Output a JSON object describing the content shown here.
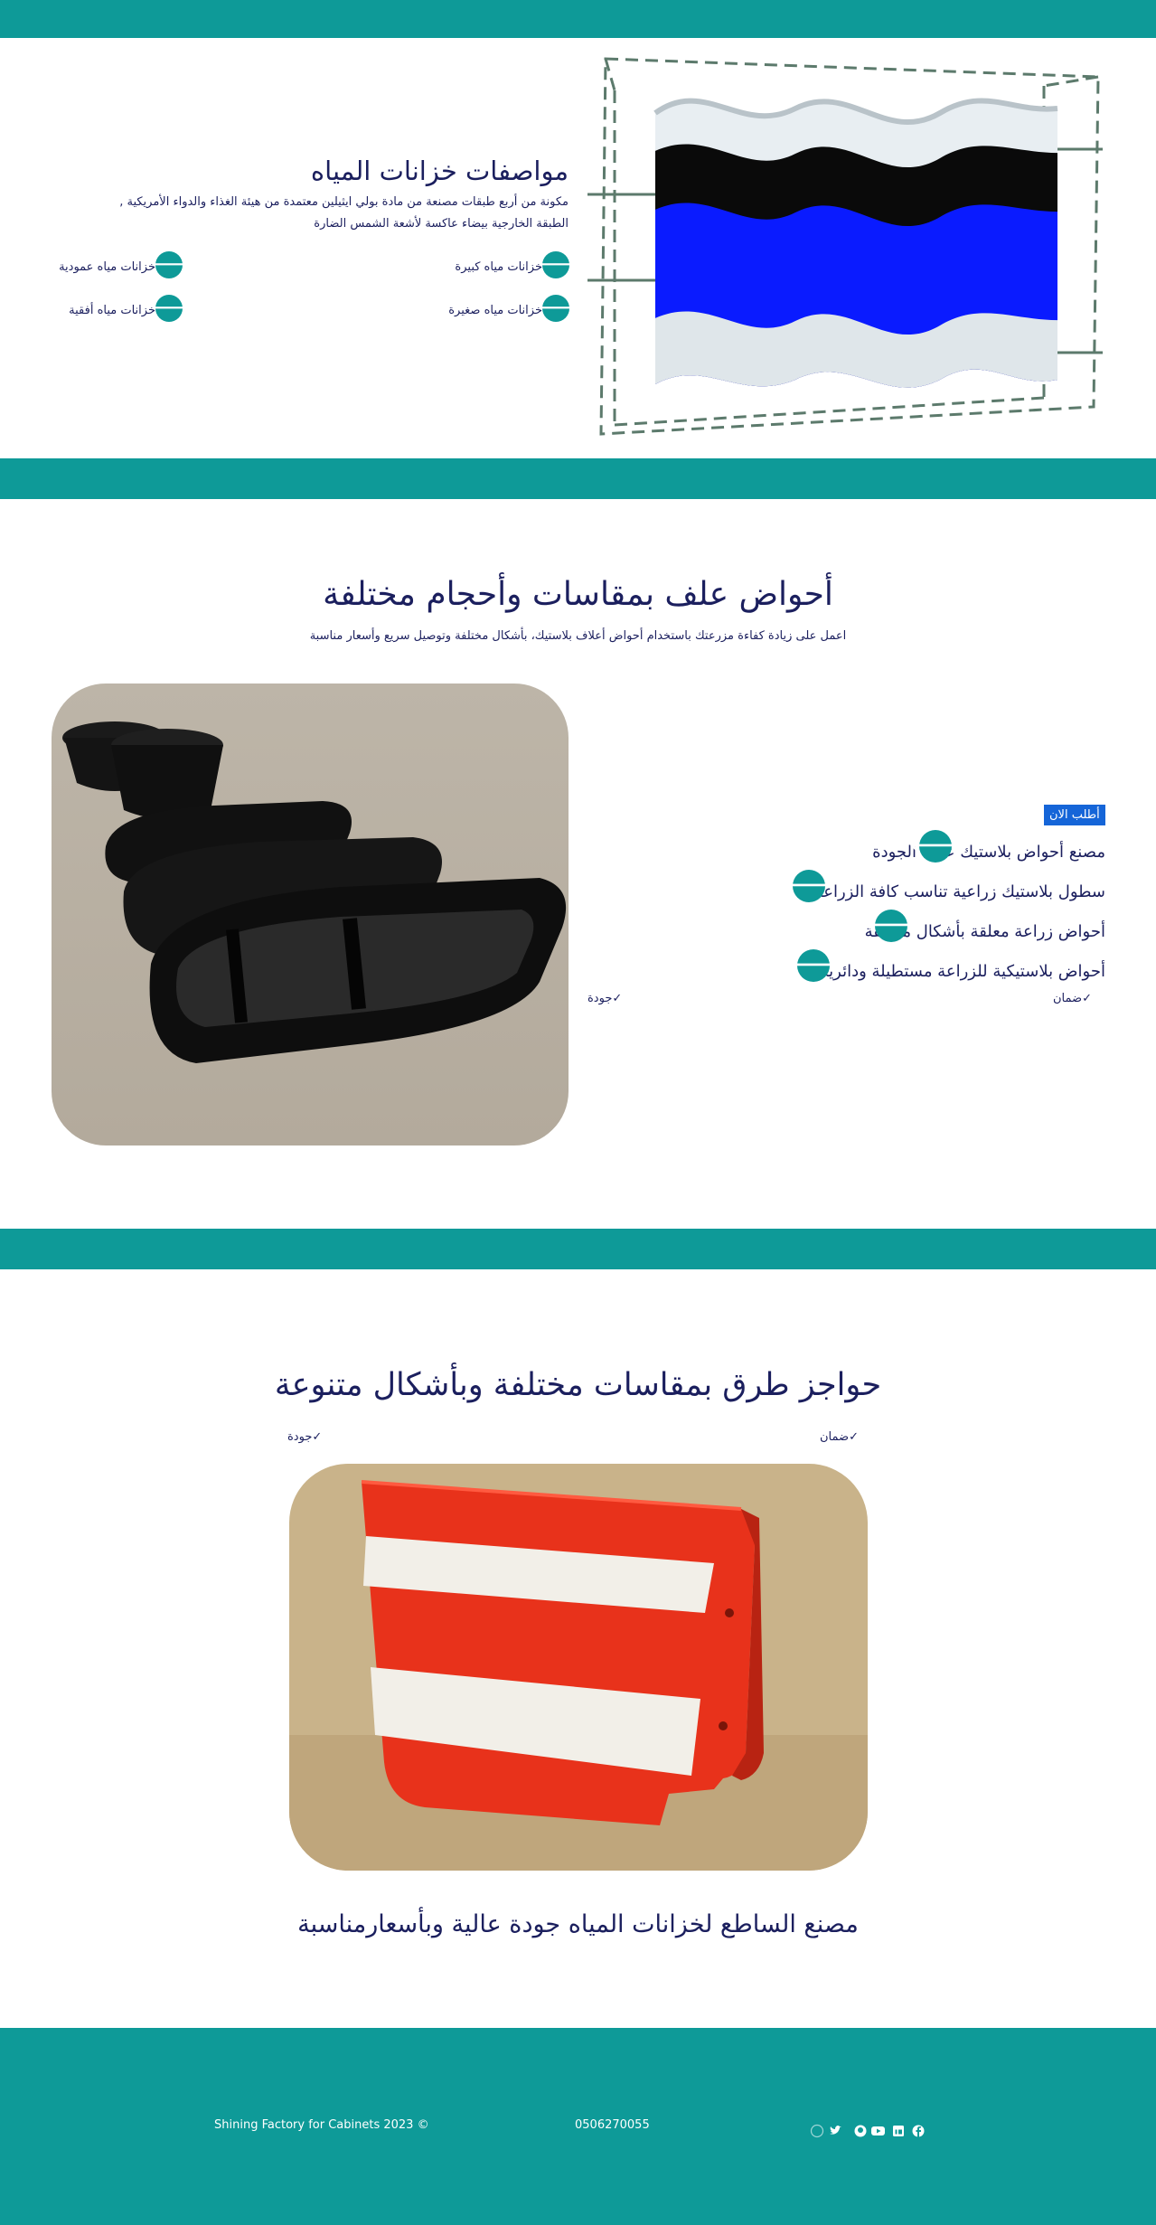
{
  "section1": {
    "title": "مواصفات خزانات المياه",
    "desc_line1": "مكونة من أربع طبقات مصنعة من مادة بولي ايثيلين معتمدة من هيئة الغذاء والدواء الأمريكية ,",
    "desc_line2": "الطبقة الخارجية بيضاء عاكسة لأشعة الشمس الضارة",
    "links": [
      "خزانات مياه كبيرة",
      "خزانات مياه عمودية",
      "خزانات مياه صغيرة",
      "خزانات مياه أفقية"
    ],
    "arrow": "🡐"
  },
  "section2": {
    "title": "أحواض علف بمقاسات وأحجام مختلفة",
    "subtitle": "اعمل على زيادة كفاءة مزرعتك باستخدام أحواض أعلاف بلاستيك، بأشكال مختلفة وتوصيل سريع وأسعار مناسبة",
    "order_button": "أطلب الان",
    "items": [
      "مصنع أحواض بلاستيك عالية الجودة",
      "سطول بلاستيك زراعية تناسب كافة الزراعات",
      "أحواض زراعة معلقة بأشكال مختلفة",
      "أحواض بلاستيكية للزراعة مستطيلة ودائرية"
    ],
    "badge_guarantee": "ضمان",
    "badge_quality": "جودة",
    "check": "✓"
  },
  "section3": {
    "title": "حواجز طرق بمقاسات مختلفة وبأشكال متنوعة",
    "badge_guarantee": "ضمان",
    "badge_quality": "جودة",
    "tagline": "مصنع الساطع لخزانات المياه جودة عالية وبأسعارمناسبة"
  },
  "footer": {
    "copyright": "Shining Factory for Cabinets 2023 ©",
    "phone": "0506270055",
    "social": [
      "facebook-icon",
      "linkedin-icon",
      "youtube-icon",
      "github-icon",
      "twitter-icon",
      "dribbble-icon"
    ]
  },
  "colors": {
    "teal": "#0e9a98",
    "navy": "#1b1f5e",
    "blue_button": "#1565d8"
  }
}
